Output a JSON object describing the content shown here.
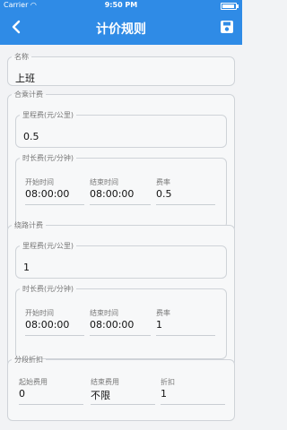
{
  "status": {
    "carrier": "Carrier",
    "time": "9:50 PM"
  },
  "header": {
    "title": "计价规则"
  },
  "name": {
    "label": "名称",
    "value": "上班"
  },
  "combined": {
    "label": "合乘计费",
    "mileage": {
      "label": "里程费(元/公里)",
      "value": "0.5"
    },
    "duration": {
      "label": "时长费(元/分钟)",
      "start_label": "开始时间",
      "start_value": "08:00:00",
      "end_label": "结束时间",
      "end_value": "08:00:00",
      "rate_label": "费率",
      "rate_value": "0.5"
    }
  },
  "detour": {
    "label": "绕路计费",
    "mileage": {
      "label": "里程费(元/公里)",
      "value": "1"
    },
    "duration": {
      "label": "时长费(元/分钟)",
      "start_label": "开始时间",
      "start_value": "08:00:00",
      "end_label": "结束时间",
      "end_value": "08:00:00",
      "rate_label": "费率",
      "rate_value": "1"
    }
  },
  "discount": {
    "label": "分段折扣",
    "start_label": "起始费用",
    "start_value": "0",
    "end_label": "结束费用",
    "end_value": "不限",
    "rate_label": "折扣",
    "rate_value": "1"
  }
}
